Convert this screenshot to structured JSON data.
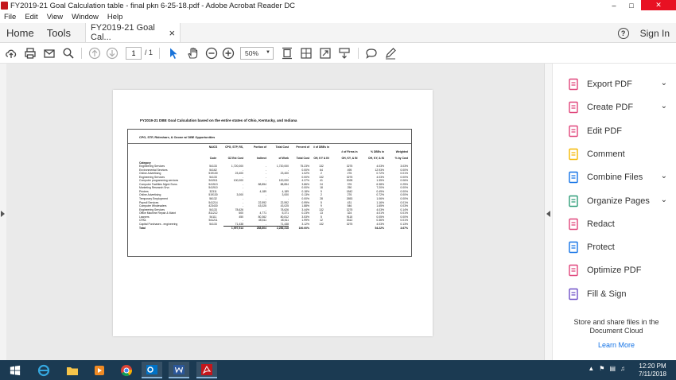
{
  "window": {
    "title": "FY2019-21 Goal Calculation table - final pkn 6-25-18.pdf - Adobe Acrobat Reader DC",
    "min": "–",
    "max": "□",
    "close": "✕"
  },
  "menu": [
    "File",
    "Edit",
    "View",
    "Window",
    "Help"
  ],
  "tabs": {
    "home": "Home",
    "tools": "Tools",
    "doc": "FY2019-21 Goal Cal...",
    "doc_close": "×",
    "help": "?",
    "signin": "Sign In"
  },
  "toolbar": {
    "page_current": "1",
    "page_total": "/ 1",
    "zoom": "50%"
  },
  "document": {
    "title": "FY2019-21 DBE Goal Calculation based on the entire states of Ohio, Kentucky, and Indiana",
    "subtitle": "CPG, STP, Rideshare, & Ozone w/ DBE Opportunities",
    "headers_top": [
      "NAICS",
      "CPG, STP, RS,",
      "Portion of",
      "Total Cost",
      "Percent of",
      "# of DBEs in",
      "# of Firms in",
      "% DBEs in",
      "Weighted"
    ],
    "headers_bottom": [
      "Category",
      "Code",
      "OZ Est Cost",
      "Indirect",
      "of Work",
      "Total Cost",
      "OH, KY & IN",
      "OH, KY, & IN",
      "OH, KY, & IN",
      "% by Cost"
    ],
    "rows": [
      [
        "Engineering Services",
        "54133",
        "1,720,000",
        "-",
        "1,720,000",
        "75.23%",
        "132",
        "3275",
        "4.03%",
        "3.03%"
      ],
      [
        "Environmental Services",
        "54162",
        "-",
        "-",
        "-",
        "0.00%",
        "64",
        "495",
        "12.93%",
        "0.00%"
      ],
      [
        "Online Advertising",
        "519130",
        "23,400",
        "-",
        "23,400",
        "1.02%",
        "2",
        "276",
        "0.72%",
        "0.01%"
      ],
      [
        "Engineering Services",
        "54133",
        "-",
        "-",
        "-",
        "0.00%",
        "132",
        "3275",
        "4.03%",
        "0.00%"
      ],
      [
        "Computer programming services",
        "541511",
        "100,000",
        "-",
        "100,000",
        "4.37%",
        "41",
        "3028",
        "1.35%",
        "0.06%"
      ],
      [
        "Computer Facilities Mgmt Srvcs",
        "541513",
        "-",
        "88,854",
        "88,854",
        "3.86%",
        "24",
        "376",
        "6.38%",
        "0.25%"
      ],
      [
        "Marketing Research Srvc",
        "541910",
        "-",
        "-",
        "-",
        "0.00%",
        "18",
        "250",
        "7.20%",
        "0.00%"
      ],
      [
        "Printers",
        "32311",
        "-",
        "4,189",
        "4,189",
        "0.18%",
        "9",
        "1842",
        "0.49%",
        "0.00%"
      ],
      [
        "Online Advertising",
        "519130",
        "3,000",
        "-",
        "3,000",
        "0.13%",
        "2",
        "276",
        "0.72%",
        "0.00%"
      ],
      [
        "Temporary Employment",
        "56132",
        "-",
        "-",
        "-",
        "0.00%",
        "28",
        "2653",
        "1.06%",
        "0.00%"
      ],
      [
        "Payroll Services",
        "541214",
        "-",
        "22,592",
        "22,592",
        "0.99%",
        "5",
        "431",
        "1.16%",
        "0.01%"
      ],
      [
        "Computer Wholesalers",
        "423430",
        "-",
        "43,025",
        "43,025",
        "1.88%",
        "9",
        "546",
        "1.65%",
        "0.03%"
      ],
      [
        "Engineering Services",
        "54133",
        "78,626",
        "-",
        "78,626",
        "3.44%",
        "132",
        "3275",
        "4.03%",
        "0.14%"
      ],
      [
        "Office Machine Repair & Maint",
        "811212",
        "600",
        "4,771",
        "5,371",
        "0.23%",
        "13",
        "324",
        "4.01%",
        "0.01%"
      ],
      [
        "Lawyers",
        "54111",
        "450",
        "80,362",
        "80,812",
        "3.53%",
        "5",
        "9115",
        "0.05%",
        "0.00%"
      ],
      [
        "CPAs",
        "541211",
        "-",
        "45,511",
        "45,511",
        "1.99%",
        "12",
        "3312",
        "0.36%",
        "0.01%"
      ],
      [
        "Capital Purchases - engineering",
        "54133",
        "71,438",
        "-",
        "71,438",
        "3.12%",
        "132",
        "3275",
        "4.03%",
        "0.13%"
      ],
      [
        "Total",
        "",
        "1,997,514",
        "288,804",
        "2,286,318",
        "100.00%",
        "",
        "",
        "54.22%",
        "3.67%"
      ]
    ]
  },
  "tools_panel": {
    "items": [
      {
        "label": "Export PDF",
        "chevron": "⌄",
        "color": "#e0457b"
      },
      {
        "label": "Create PDF",
        "chevron": "⌄",
        "color": "#e0457b"
      },
      {
        "label": "Edit PDF",
        "chevron": "",
        "color": "#e0457b"
      },
      {
        "label": "Comment",
        "chevron": "",
        "color": "#f5b800"
      },
      {
        "label": "Combine Files",
        "chevron": "⌄",
        "color": "#1473e6"
      },
      {
        "label": "Organize Pages",
        "chevron": "⌄",
        "color": "#2d9d78"
      },
      {
        "label": "Redact",
        "chevron": "",
        "color": "#e0457b"
      },
      {
        "label": "Protect",
        "chevron": "",
        "color": "#1473e6"
      },
      {
        "label": "Optimize PDF",
        "chevron": "",
        "color": "#e0457b"
      },
      {
        "label": "Fill & Sign",
        "chevron": "",
        "color": "#6e4fc7"
      }
    ],
    "store_text": "Store and share files in the Document Cloud",
    "learn_more": "Learn More"
  },
  "taskbar": {
    "time": "12:20 PM",
    "date": "7/11/2018"
  }
}
